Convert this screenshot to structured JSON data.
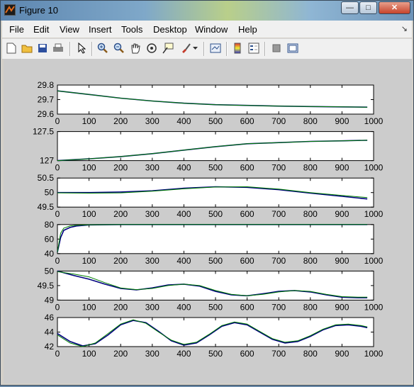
{
  "window": {
    "title": "Figure 10",
    "controls": {
      "minimize": "—",
      "maximize": "□",
      "close": "✕"
    }
  },
  "menu": {
    "items": [
      "File",
      "Edit",
      "View",
      "Insert",
      "Tools",
      "Desktop",
      "Window",
      "Help"
    ],
    "overflow": "↘"
  },
  "toolbar": {
    "icons": [
      "new-figure-icon",
      "open-file-icon",
      "save-icon",
      "print-icon",
      "edit-plot-arrow-icon",
      "zoom-in-icon",
      "zoom-out-icon",
      "pan-hand-icon",
      "rotate-3d-icon",
      "data-cursor-icon",
      "brush-icon",
      "brush-dropdown-icon",
      "link-plot-icon",
      "insert-colorbar-icon",
      "insert-legend-icon",
      "hide-plot-tools-icon",
      "show-plot-tools-icon"
    ]
  },
  "colors": {
    "series_measured": "#00007f",
    "series_model": "#007f00",
    "axes_bg": "#ffffff",
    "figure_bg": "#cccccc"
  },
  "chart_data": [
    {
      "type": "line",
      "xlim": [
        0,
        1000
      ],
      "ylim": [
        29.6,
        29.8
      ],
      "xticks": [
        "0",
        "100",
        "200",
        "300",
        "400",
        "500",
        "600",
        "700",
        "800",
        "900",
        "1000"
      ],
      "yticks": [
        "29.6",
        "29.7",
        "29.8"
      ],
      "series": [
        {
          "x": [
            0,
            100,
            200,
            300,
            400,
            500,
            600,
            700,
            800,
            900,
            980
          ],
          "values": [
            29.76,
            29.735,
            29.71,
            29.69,
            29.675,
            29.665,
            29.66,
            29.655,
            29.652,
            29.65,
            29.648
          ]
        },
        {
          "x": [
            0,
            100,
            200,
            300,
            400,
            500,
            600,
            700,
            800,
            900,
            980
          ],
          "values": [
            29.76,
            29.735,
            29.71,
            29.69,
            29.675,
            29.665,
            29.66,
            29.655,
            29.652,
            29.65,
            29.648
          ]
        }
      ]
    },
    {
      "type": "line",
      "xlim": [
        0,
        1000
      ],
      "ylim": [
        127,
        127.5
      ],
      "xticks": [
        "0",
        "100",
        "200",
        "300",
        "400",
        "500",
        "600",
        "700",
        "800",
        "900",
        "1000"
      ],
      "yticks": [
        "127",
        "127.5"
      ],
      "series": [
        {
          "x": [
            0,
            100,
            200,
            300,
            400,
            500,
            600,
            700,
            800,
            900,
            980
          ],
          "values": [
            127.0,
            127.03,
            127.07,
            127.12,
            127.18,
            127.24,
            127.29,
            127.31,
            127.33,
            127.34,
            127.35
          ]
        },
        {
          "x": [
            0,
            100,
            200,
            300,
            400,
            500,
            600,
            700,
            800,
            900,
            980
          ],
          "values": [
            127.0,
            127.03,
            127.07,
            127.12,
            127.18,
            127.24,
            127.29,
            127.31,
            127.33,
            127.34,
            127.35
          ]
        }
      ]
    },
    {
      "type": "line",
      "xlim": [
        0,
        1000
      ],
      "ylim": [
        49.5,
        50.5
      ],
      "xticks": [
        "0",
        "100",
        "200",
        "300",
        "400",
        "500",
        "600",
        "700",
        "800",
        "900",
        "1000"
      ],
      "yticks": [
        "49.5",
        "50",
        "50.5"
      ],
      "series": [
        {
          "x": [
            0,
            100,
            200,
            300,
            400,
            500,
            600,
            700,
            800,
            900,
            980
          ],
          "values": [
            50.0,
            50.0,
            50.02,
            50.06,
            50.15,
            50.2,
            50.18,
            50.1,
            49.98,
            49.87,
            49.78
          ]
        },
        {
          "x": [
            0,
            100,
            200,
            300,
            400,
            500,
            600,
            700,
            800,
            900,
            980
          ],
          "values": [
            49.99,
            49.98,
            49.99,
            50.05,
            50.13,
            50.19,
            50.2,
            50.12,
            50.0,
            49.9,
            49.83
          ]
        }
      ]
    },
    {
      "type": "line",
      "xlim": [
        0,
        1000
      ],
      "ylim": [
        40,
        80
      ],
      "xticks": [
        "0",
        "100",
        "200",
        "300",
        "400",
        "500",
        "600",
        "700",
        "800",
        "900",
        "1000"
      ],
      "yticks": [
        "40",
        "60",
        "80"
      ],
      "series": [
        {
          "x": [
            0,
            10,
            20,
            40,
            60,
            100,
            200,
            400,
            600,
            800,
            980
          ],
          "values": [
            42,
            62,
            72,
            76,
            78,
            79.5,
            80,
            80,
            80,
            80,
            80
          ]
        },
        {
          "x": [
            0,
            10,
            20,
            40,
            60,
            100,
            200,
            400,
            600,
            800,
            980
          ],
          "values": [
            42,
            68,
            75,
            78,
            79,
            79.7,
            80,
            80,
            80,
            80,
            80
          ]
        }
      ]
    },
    {
      "type": "line",
      "xlim": [
        0,
        1000
      ],
      "ylim": [
        49,
        50
      ],
      "xticks": [
        "0",
        "100",
        "200",
        "300",
        "400",
        "500",
        "600",
        "700",
        "800",
        "900",
        "1000"
      ],
      "yticks": [
        "49",
        "49.5",
        "50"
      ],
      "series": [
        {
          "x": [
            0,
            50,
            100,
            150,
            200,
            250,
            300,
            350,
            400,
            450,
            500,
            550,
            600,
            650,
            700,
            750,
            800,
            850,
            900,
            950,
            980
          ],
          "values": [
            50.0,
            49.85,
            49.72,
            49.55,
            49.4,
            49.35,
            49.42,
            49.52,
            49.55,
            49.48,
            49.3,
            49.18,
            49.15,
            49.22,
            49.3,
            49.33,
            49.28,
            49.18,
            49.1,
            49.08,
            49.08
          ]
        },
        {
          "x": [
            0,
            50,
            100,
            150,
            200,
            250,
            300,
            350,
            400,
            450,
            500,
            550,
            600,
            650,
            700,
            750,
            800,
            850,
            900,
            950,
            980
          ],
          "values": [
            49.98,
            49.9,
            49.8,
            49.6,
            49.42,
            49.36,
            49.4,
            49.5,
            49.55,
            49.5,
            49.33,
            49.2,
            49.15,
            49.2,
            49.28,
            49.33,
            49.3,
            49.2,
            49.12,
            49.1,
            49.1
          ]
        }
      ]
    },
    {
      "type": "line",
      "xlim": [
        0,
        1000
      ],
      "ylim": [
        42,
        46
      ],
      "xticks": [
        "0",
        "100",
        "200",
        "300",
        "400",
        "500",
        "600",
        "700",
        "800",
        "900",
        "1000"
      ],
      "yticks": [
        "42",
        "44",
        "46"
      ],
      "series": [
        {
          "x": [
            0,
            40,
            80,
            120,
            160,
            200,
            240,
            280,
            320,
            360,
            400,
            440,
            480,
            520,
            560,
            600,
            640,
            680,
            720,
            760,
            800,
            840,
            880,
            920,
            960,
            980
          ],
          "values": [
            43.8,
            42.7,
            42.1,
            42.4,
            43.6,
            45.0,
            45.6,
            45.3,
            44.1,
            42.8,
            42.2,
            42.5,
            43.6,
            44.8,
            45.3,
            45.0,
            44.0,
            43.0,
            42.5,
            42.7,
            43.4,
            44.3,
            44.9,
            45.0,
            44.8,
            44.6
          ]
        },
        {
          "x": [
            0,
            40,
            80,
            120,
            160,
            200,
            240,
            280,
            320,
            360,
            400,
            440,
            480,
            520,
            560,
            600,
            640,
            680,
            720,
            760,
            800,
            840,
            880,
            920,
            960,
            980
          ],
          "values": [
            43.6,
            42.5,
            42.0,
            42.5,
            43.8,
            45.1,
            45.7,
            45.2,
            44.0,
            42.9,
            42.3,
            42.6,
            43.7,
            44.9,
            45.4,
            45.1,
            44.1,
            43.1,
            42.6,
            42.8,
            43.5,
            44.4,
            45.0,
            45.1,
            44.9,
            44.7
          ]
        }
      ]
    }
  ]
}
